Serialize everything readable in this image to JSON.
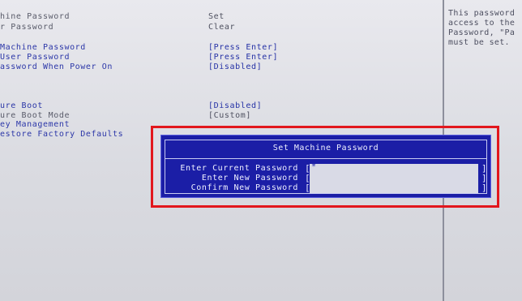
{
  "settings": [
    {
      "label": "hine Password",
      "value": "Set"
    },
    {
      "label": "r Password",
      "value": "Clear"
    },
    {
      "label": " Machine Password",
      "value": "[Press Enter]"
    },
    {
      "label": " User Password",
      "value": "[Press Enter]"
    },
    {
      "label": "assword When Power On",
      "value": "[Disabled]"
    },
    {
      "label": "ure Boot",
      "value": "[Disabled]"
    },
    {
      "label": "ure Boot Mode",
      "value": "[Custom]"
    },
    {
      "label": "ey Management",
      "value": ""
    },
    {
      "label": "estore Factory Defaults",
      "value": ""
    }
  ],
  "help_text": [
    "This password",
    "access to the",
    "Password, \"Pa",
    "must be set."
  ],
  "dialog": {
    "title": "Set Machine Password",
    "fields": [
      {
        "label": "Enter Current Password",
        "value": "*"
      },
      {
        "label": "Enter New Password",
        "value": ""
      },
      {
        "label": "Confirm New Password",
        "value": ""
      }
    ]
  },
  "colors": {
    "dialog_bg": "#1b1ea6",
    "highlight_frame": "#e2171d",
    "screen_bg": "#dcdde2"
  }
}
